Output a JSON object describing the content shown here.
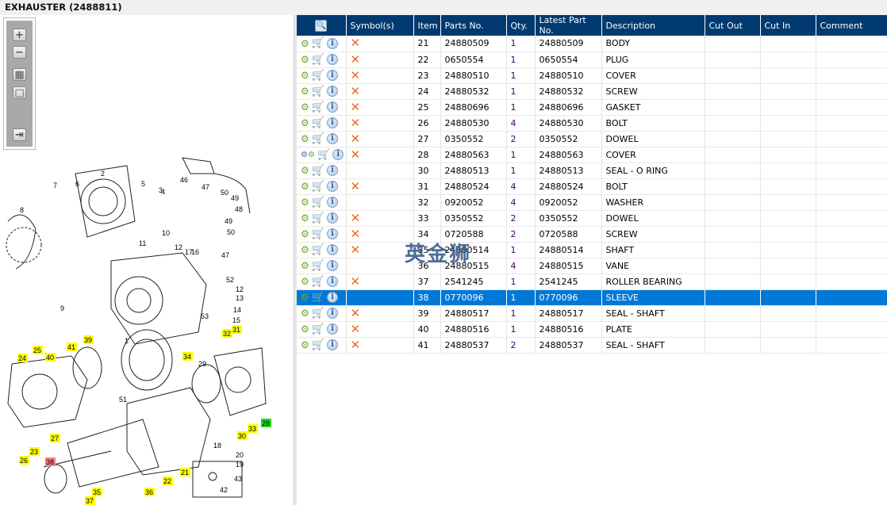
{
  "title": "EXHAUSTER (2488811)",
  "toolbar": {
    "zoom_in": "+",
    "zoom_out": "−",
    "fit": "▦",
    "actual": "□",
    "export": "⇥"
  },
  "watermark": "英金狮",
  "table": {
    "headers": [
      "",
      "Symbol(s)",
      "Item",
      "Parts No.",
      "Qty.",
      "Latest Part No.",
      "Description",
      "Cut Out",
      "Cut In",
      "Comment"
    ],
    "rows": [
      {
        "icon": "gear",
        "symbol": "x",
        "item": "21",
        "part": "24880509",
        "qty": "1",
        "latest": "24880509",
        "desc": "BODY"
      },
      {
        "icon": "gear",
        "symbol": "x",
        "item": "22",
        "part": "0650554",
        "qty": "1",
        "latest": "0650554",
        "desc": "PLUG"
      },
      {
        "icon": "gear",
        "symbol": "x",
        "item": "23",
        "part": "24880510",
        "qty": "1",
        "latest": "24880510",
        "desc": "COVER"
      },
      {
        "icon": "gear",
        "symbol": "x",
        "item": "24",
        "part": "24880532",
        "qty": "1",
        "latest": "24880532",
        "desc": "SCREW"
      },
      {
        "icon": "gear",
        "symbol": "x",
        "item": "25",
        "part": "24880696",
        "qty": "1",
        "latest": "24880696",
        "desc": "GASKET"
      },
      {
        "icon": "gear",
        "symbol": "x",
        "item": "26",
        "part": "24880530",
        "qty": "4",
        "latest": "24880530",
        "desc": "BOLT"
      },
      {
        "icon": "gear",
        "symbol": "x",
        "item": "27",
        "part": "0350552",
        "qty": "2",
        "latest": "0350552",
        "desc": "DOWEL"
      },
      {
        "icon": "gears",
        "symbol": "x",
        "item": "28",
        "part": "24880563",
        "qty": "1",
        "latest": "24880563",
        "desc": "COVER"
      },
      {
        "icon": "gear",
        "symbol": "",
        "item": "30",
        "part": "24880513",
        "qty": "1",
        "latest": "24880513",
        "desc": "SEAL - O RING"
      },
      {
        "icon": "gear",
        "symbol": "x",
        "item": "31",
        "part": "24880524",
        "qty": "4",
        "latest": "24880524",
        "desc": "BOLT"
      },
      {
        "icon": "gear",
        "symbol": "",
        "item": "32",
        "part": "0920052",
        "qty": "4",
        "latest": "0920052",
        "desc": "WASHER"
      },
      {
        "icon": "gear",
        "symbol": "x",
        "item": "33",
        "part": "0350552",
        "qty": "2",
        "latest": "0350552",
        "desc": "DOWEL"
      },
      {
        "icon": "gear",
        "symbol": "x",
        "item": "34",
        "part": "0720588",
        "qty": "2",
        "latest": "0720588",
        "desc": "SCREW"
      },
      {
        "icon": "gear",
        "symbol": "x",
        "item": "35",
        "part": "24880514",
        "qty": "1",
        "latest": "24880514",
        "desc": "SHAFT"
      },
      {
        "icon": "gear",
        "symbol": "",
        "item": "36",
        "part": "24880515",
        "qty": "4",
        "latest": "24880515",
        "desc": "VANE"
      },
      {
        "icon": "gear",
        "symbol": "x",
        "item": "37",
        "part": "2541245",
        "qty": "1",
        "latest": "2541245",
        "desc": "ROLLER BEARING"
      },
      {
        "icon": "gear",
        "symbol": "",
        "item": "38",
        "part": "0770096",
        "qty": "1",
        "latest": "0770096",
        "desc": "SLEEVE",
        "selected": true
      },
      {
        "icon": "gear",
        "symbol": "x",
        "item": "39",
        "part": "24880517",
        "qty": "1",
        "latest": "24880517",
        "desc": "SEAL - SHAFT"
      },
      {
        "icon": "gear",
        "symbol": "x",
        "item": "40",
        "part": "24880516",
        "qty": "1",
        "latest": "24880516",
        "desc": "PLATE"
      },
      {
        "icon": "gear",
        "symbol": "x",
        "item": "41",
        "part": "24880537",
        "qty": "2",
        "latest": "24880537",
        "desc": "SEAL - SHAFT"
      }
    ]
  },
  "diagram": {
    "callouts": [
      {
        "label": "2",
        "hl": ""
      },
      {
        "label": "3",
        "hl": ""
      },
      {
        "label": "4",
        "hl": ""
      },
      {
        "label": "5",
        "hl": ""
      },
      {
        "label": "6",
        "hl": ""
      },
      {
        "label": "7",
        "hl": ""
      },
      {
        "label": "8",
        "hl": ""
      },
      {
        "label": "9",
        "hl": ""
      },
      {
        "label": "10",
        "hl": ""
      },
      {
        "label": "11",
        "hl": ""
      },
      {
        "label": "12",
        "hl": ""
      },
      {
        "label": "17",
        "hl": ""
      },
      {
        "label": "16",
        "hl": ""
      },
      {
        "label": "46",
        "hl": ""
      },
      {
        "label": "47",
        "hl": ""
      },
      {
        "label": "50",
        "hl": ""
      },
      {
        "label": "49",
        "hl": ""
      },
      {
        "label": "48",
        "hl": ""
      },
      {
        "label": "49",
        "hl": ""
      },
      {
        "label": "50",
        "hl": ""
      },
      {
        "label": "47",
        "hl": ""
      },
      {
        "label": "52",
        "hl": ""
      },
      {
        "label": "12",
        "hl": ""
      },
      {
        "label": "13",
        "hl": ""
      },
      {
        "label": "53",
        "hl": ""
      },
      {
        "label": "14",
        "hl": ""
      },
      {
        "label": "15",
        "hl": ""
      },
      {
        "label": "1",
        "hl": ""
      },
      {
        "label": "31",
        "hl": "#ffff00"
      },
      {
        "label": "32",
        "hl": "#ffff00"
      },
      {
        "label": "39",
        "hl": "#ffff00"
      },
      {
        "label": "41",
        "hl": "#ffff00"
      },
      {
        "label": "25",
        "hl": "#ffff00"
      },
      {
        "label": "40",
        "hl": "#ffff00"
      },
      {
        "label": "24",
        "hl": "#ffff00"
      },
      {
        "label": "34",
        "hl": "#ffff00"
      },
      {
        "label": "29",
        "hl": ""
      },
      {
        "label": "51",
        "hl": ""
      },
      {
        "label": "28",
        "hl": "#22dd22"
      },
      {
        "label": "33",
        "hl": "#ffff00"
      },
      {
        "label": "30",
        "hl": "#ffff00"
      },
      {
        "label": "18",
        "hl": ""
      },
      {
        "label": "20",
        "hl": ""
      },
      {
        "label": "19",
        "hl": ""
      },
      {
        "label": "27",
        "hl": "#ffff00"
      },
      {
        "label": "23",
        "hl": "#ffff00"
      },
      {
        "label": "26",
        "hl": "#ffff00"
      },
      {
        "label": "38",
        "hl": "#ff8080"
      },
      {
        "label": "21",
        "hl": "#ffff00"
      },
      {
        "label": "22",
        "hl": "#ffff00"
      },
      {
        "label": "36",
        "hl": "#ffff00"
      },
      {
        "label": "35",
        "hl": "#ffff00"
      },
      {
        "label": "37",
        "hl": "#ffff00"
      },
      {
        "label": "43",
        "hl": ""
      },
      {
        "label": "42",
        "hl": ""
      }
    ]
  }
}
